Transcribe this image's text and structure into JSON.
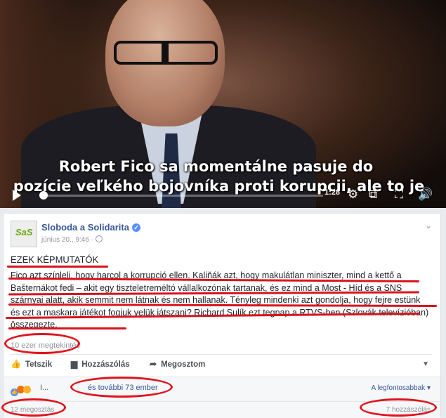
{
  "video": {
    "subtitle_line1": "Robert Fico sa momentálne pasuje do",
    "subtitle_line2": "pozície veľkého bojovníka proti korupcii, ale to je",
    "time": "1:28"
  },
  "post": {
    "page_name": "Sloboda a Solidarita",
    "avatar_text": "SaS",
    "date": "június 20., 9:46 ·",
    "headline": "EZEK KÉPMUTATÓK",
    "body": "Fico azt színleli, hogy harcol a korrupció ellen. Kaliňák azt, hogy makulátlan miniszter, mind a kettő a Bašternákot fedi – akit egy tiszteletreméltó vállalkozónak tartanak, és ez mind a Most - Híd és a SNS szárnyai alatt, akik semmit nem látnak és nem hallanak. Tényleg mindenki azt gondolja, hogy fejre estünk és ezt a maskara játékot fogjuk velük játszani? Richard Sulík ezt tegnap a RTVS-ben (Szlovák televízióban) összegezte.",
    "views": "10 ezer megtekintés",
    "actions": {
      "like": "Tetszik",
      "comment": "Hozzászólás",
      "share": "Megosztom"
    },
    "reactions": {
      "name": "I...",
      "others": "és további 73 ember",
      "sort": "A legfontosabbak"
    },
    "shares": "12 megosztás",
    "comments": "7 hozzászólás"
  },
  "colors": {
    "link": "#365899",
    "annotation_red": "#e0141c",
    "sas_green": "#6aa60a"
  }
}
